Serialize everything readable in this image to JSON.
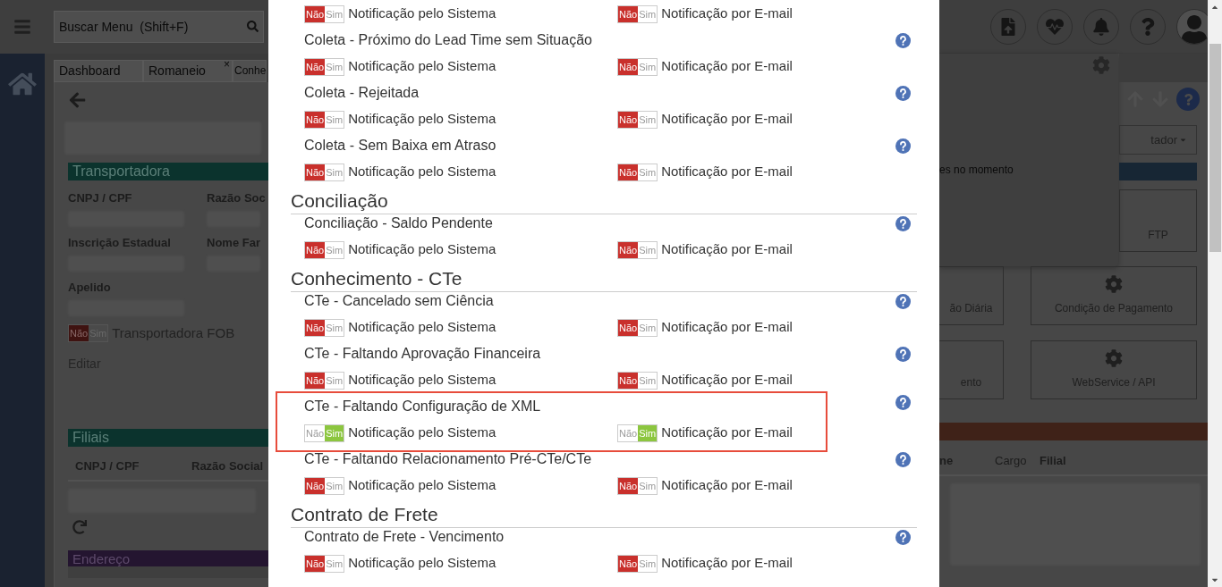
{
  "background": {
    "search": {
      "placeholder": "Buscar Menu  (Shift+F)"
    },
    "tabs": [
      {
        "label": "Dashboard"
      },
      {
        "label": "Romaneio",
        "close": "×"
      },
      {
        "label": "Conhe"
      }
    ],
    "form": {
      "section_bar": "Transportadora",
      "fields": [
        {
          "label": "CNPJ / CPF"
        },
        {
          "label": "Razão Soc"
        },
        {
          "label": "Inscrição Estadual"
        },
        {
          "label": "Nome Far"
        },
        {
          "label": "Apelido"
        }
      ],
      "toggle": {
        "options": [
          "Não",
          "Sim"
        ],
        "label": "Transportadora FOB",
        "on": false
      },
      "edit_link": "Editar",
      "branches_bar": "Filiais",
      "branches_columns": [
        "CNPJ / CPF",
        "Razão Social"
      ],
      "address_bar": "Endereço"
    },
    "notifications": {
      "empty_text": "es no momento"
    },
    "dropdown": {
      "label": "tador"
    },
    "cards": [
      {
        "label": "FTP"
      },
      {
        "label": "ão Diária"
      },
      {
        "label": "Condição de Pagamento"
      },
      {
        "label": "ento"
      },
      {
        "label": "WebService / API"
      }
    ],
    "table_columns": [
      "ne",
      "Cargo",
      "Filial"
    ]
  },
  "modal": {
    "sections": [
      {
        "events": [
          {
            "highlighted": false,
            "toggles": [
              {
                "options": [
                  "Não",
                  "Sim"
                ],
                "label": "Notificação pelo Sistema",
                "on": false
              },
              {
                "options": [
                  "Não",
                  "Sim"
                ],
                "label": "Notificação por E-mail",
                "on": false
              }
            ]
          },
          {
            "title": "Coleta - Próximo do Lead Time sem Situação",
            "highlighted": false,
            "toggles": [
              {
                "options": [
                  "Não",
                  "Sim"
                ],
                "label": "Notificação pelo Sistema",
                "on": false
              },
              {
                "options": [
                  "Não",
                  "Sim"
                ],
                "label": "Notificação por E-mail",
                "on": false
              }
            ]
          },
          {
            "title": "Coleta - Rejeitada",
            "highlighted": false,
            "toggles": [
              {
                "options": [
                  "Não",
                  "Sim"
                ],
                "label": "Notificação pelo Sistema",
                "on": false
              },
              {
                "options": [
                  "Não",
                  "Sim"
                ],
                "label": "Notificação por E-mail",
                "on": false
              }
            ]
          },
          {
            "title": "Coleta - Sem Baixa em Atraso",
            "highlighted": false,
            "toggles": [
              {
                "options": [
                  "Não",
                  "Sim"
                ],
                "label": "Notificação pelo Sistema",
                "on": false
              },
              {
                "options": [
                  "Não",
                  "Sim"
                ],
                "label": "Notificação por E-mail",
                "on": false
              }
            ]
          }
        ]
      },
      {
        "title": "Conciliação",
        "events": [
          {
            "title": "Conciliação - Saldo Pendente",
            "highlighted": false,
            "toggles": [
              {
                "options": [
                  "Não",
                  "Sim"
                ],
                "label": "Notificação pelo Sistema",
                "on": false
              },
              {
                "options": [
                  "Não",
                  "Sim"
                ],
                "label": "Notificação por E-mail",
                "on": false
              }
            ]
          }
        ]
      },
      {
        "title": "Conhecimento - CTe",
        "events": [
          {
            "title": "CTe - Cancelado sem Ciência",
            "highlighted": false,
            "toggles": [
              {
                "options": [
                  "Não",
                  "Sim"
                ],
                "label": "Notificação pelo Sistema",
                "on": false
              },
              {
                "options": [
                  "Não",
                  "Sim"
                ],
                "label": "Notificação por E-mail",
                "on": false
              }
            ]
          },
          {
            "title": "CTe - Faltando Aprovação Financeira",
            "highlighted": false,
            "toggles": [
              {
                "options": [
                  "Não",
                  "Sim"
                ],
                "label": "Notificação pelo Sistema",
                "on": false
              },
              {
                "options": [
                  "Não",
                  "Sim"
                ],
                "label": "Notificação por E-mail",
                "on": false
              }
            ]
          },
          {
            "title": "CTe - Faltando Configuração de XML",
            "highlighted": true,
            "toggles": [
              {
                "options": [
                  "Não",
                  "Sim"
                ],
                "label": "Notificação pelo Sistema",
                "on": true
              },
              {
                "options": [
                  "Não",
                  "Sim"
                ],
                "label": "Notificação por E-mail",
                "on": true
              }
            ]
          },
          {
            "title": "CTe - Faltando Relacionamento Pré-CTe/CTe",
            "highlighted": false,
            "toggles": [
              {
                "options": [
                  "Não",
                  "Sim"
                ],
                "label": "Notificação pelo Sistema",
                "on": false
              },
              {
                "options": [
                  "Não",
                  "Sim"
                ],
                "label": "Notificação por E-mail",
                "on": false
              }
            ]
          }
        ]
      },
      {
        "title": "Contrato de Frete",
        "events": [
          {
            "title": "Contrato de Frete - Vencimento",
            "highlighted": false,
            "toggles": [
              {
                "options": [
                  "Não",
                  "Sim"
                ],
                "label": "Notificação pelo Sistema",
                "on": false
              },
              {
                "options": [
                  "Não",
                  "Sim"
                ],
                "label": "Notificação por E-mail",
                "on": false
              }
            ]
          }
        ]
      }
    ]
  }
}
